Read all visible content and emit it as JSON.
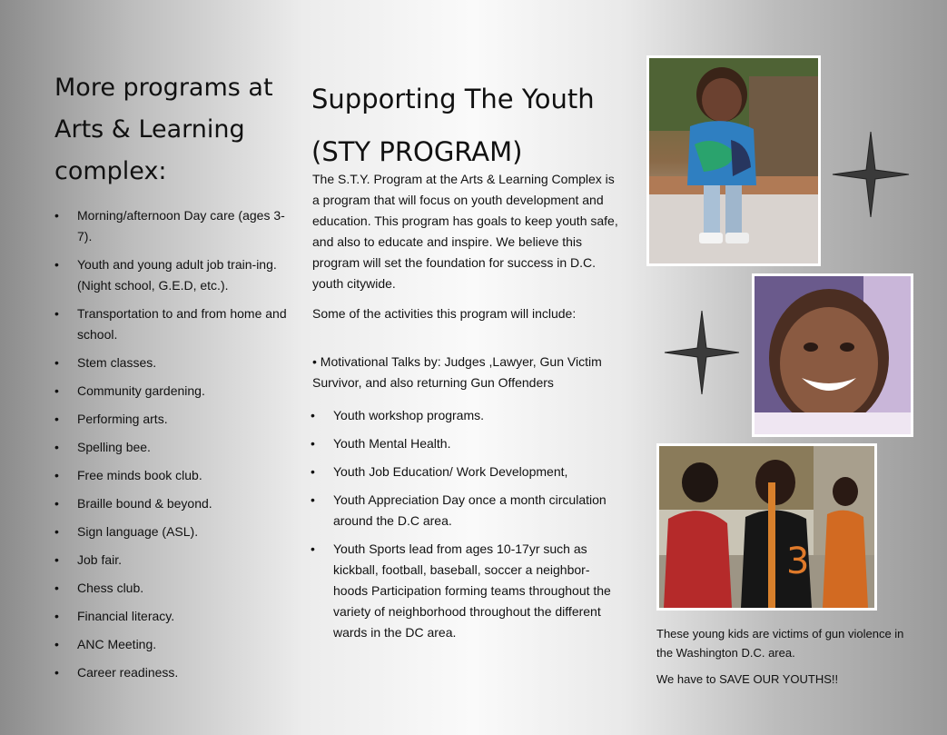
{
  "left": {
    "heading": "More programs at Arts & Learning complex:",
    "items": [
      "Morning/afternoon Day care (ages 3-7).",
      "Youth and young adult job train-ing. (Night school, G.E.D, etc.).",
      "Transportation to and from home and school.",
      "Stem classes.",
      "Community gardening.",
      "Performing arts.",
      "Spelling bee.",
      "Free minds book club.",
      "Braille bound & beyond.",
      "Sign language (ASL).",
      "Job fair.",
      "Chess club.",
      "Financial literacy.",
      "ANC Meeting.",
      "Career readiness."
    ]
  },
  "middle": {
    "title": "Supporting The Youth (STY PROGRAM)",
    "intro": "The S.T.Y. Program at the Arts & Learning Complex is a program that will focus on youth development and education. This program has goals to keep youth safe, and also to educate and inspire. We believe this program will set the foundation for success in D.C. youth citywide.",
    "activities_intro": "Some of the activities this program will include:",
    "motivational": "• Motivational Talks by: Judges ,Lawyer, Gun Victim Survivor, and also returning Gun Offenders",
    "items": [
      "Youth workshop programs.",
      "Youth Mental Health.",
      "Youth Job Education/ Work Development,",
      "Youth Appreciation Day once a month circulation around the D.C area.",
      "Youth Sports lead from ages 10-17yr such as kickball, football, baseball, soccer a neighbor-hoods Participation forming teams throughout the variety of neighborhood throughout the different wards in the DC area."
    ]
  },
  "right": {
    "caption": "These young kids are victims of gun violence in the Washington D.C. area.",
    "callout": "We have to SAVE OUR YOUTHS!!",
    "jersey_number": "3"
  }
}
